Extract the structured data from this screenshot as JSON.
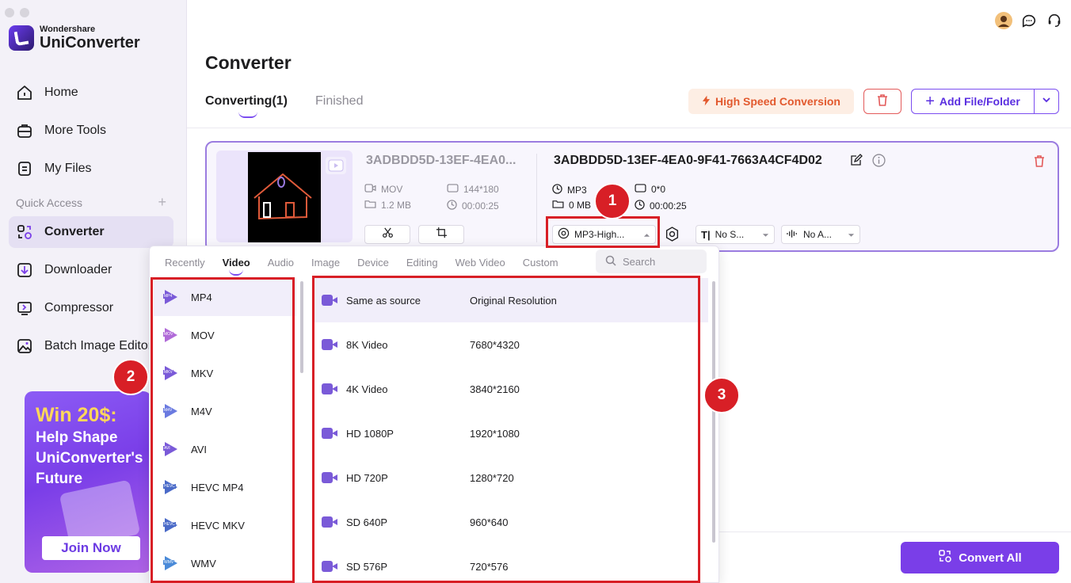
{
  "app": {
    "brand_small": "Wondershare",
    "brand_big": "UniConverter"
  },
  "sidebar": {
    "items": [
      {
        "label": "Home",
        "icon": "home-icon"
      },
      {
        "label": "More Tools",
        "icon": "toolbox-icon"
      },
      {
        "label": "My Files",
        "icon": "files-icon"
      }
    ],
    "quick_access": "Quick Access",
    "quick_items": [
      {
        "label": "Converter",
        "icon": "converter-icon",
        "active": true
      },
      {
        "label": "Downloader",
        "icon": "downloader-icon"
      },
      {
        "label": "Compressor",
        "icon": "compressor-icon"
      },
      {
        "label": "Batch Image Editor",
        "icon": "image-editor-icon"
      }
    ],
    "promo": {
      "line1": "Win 20$:",
      "line2": "Help Shape UniConverter's Future",
      "button": "Join Now"
    }
  },
  "main": {
    "title": "Converter",
    "tabs": [
      {
        "label": "Converting(1)",
        "active": true
      },
      {
        "label": "Finished",
        "active": false
      }
    ],
    "high_speed": "High Speed Conversion",
    "add_file": "Add File/Folder",
    "convert_all": "Convert All"
  },
  "file": {
    "source_name": "3ADBDD5D-13EF-4EA0...",
    "source_format": "MOV",
    "source_resolution": "144*180",
    "source_size": "1.2 MB",
    "source_duration": "00:00:25",
    "target_name": "3ADBDD5D-13EF-4EA0-9F41-7663A4CF4D02",
    "target_format": "MP3",
    "target_resolution": "0*0",
    "target_size": "0 MB",
    "target_duration": "00:00:25",
    "format_dropdown": "MP3-High...",
    "subtitle_dropdown": "No S...",
    "audio_dropdown": "No A..."
  },
  "panel": {
    "tabs": [
      "Recently",
      "Video",
      "Audio",
      "Image",
      "Device",
      "Editing",
      "Web Video",
      "Custom"
    ],
    "active_tab": "Video",
    "search_placeholder": "Search",
    "formats": [
      {
        "label": "MP4",
        "badge": "MP4"
      },
      {
        "label": "MOV",
        "badge": "MOV"
      },
      {
        "label": "MKV",
        "badge": "MKV"
      },
      {
        "label": "M4V",
        "badge": "M4V"
      },
      {
        "label": "AVI",
        "badge": "AVI"
      },
      {
        "label": "HEVC MP4",
        "badge": "HEVC"
      },
      {
        "label": "HEVC MKV",
        "badge": "HEVC"
      },
      {
        "label": "WMV",
        "badge": "WMV"
      }
    ],
    "resolutions": [
      {
        "name": "Same as source",
        "value": "Original Resolution"
      },
      {
        "name": "8K Video",
        "value": "7680*4320"
      },
      {
        "name": "4K Video",
        "value": "3840*2160"
      },
      {
        "name": "HD 1080P",
        "value": "1920*1080"
      },
      {
        "name": "HD 720P",
        "value": "1280*720"
      },
      {
        "name": "SD 640P",
        "value": "960*640"
      },
      {
        "name": "SD 576P",
        "value": "720*576"
      }
    ]
  },
  "annotations": {
    "markers": [
      "1",
      "2",
      "3"
    ],
    "color": "#d81f26"
  },
  "colors": {
    "accent": "#7a3ee8",
    "high_speed": "#e2592e",
    "delete": "#e35a5a"
  }
}
